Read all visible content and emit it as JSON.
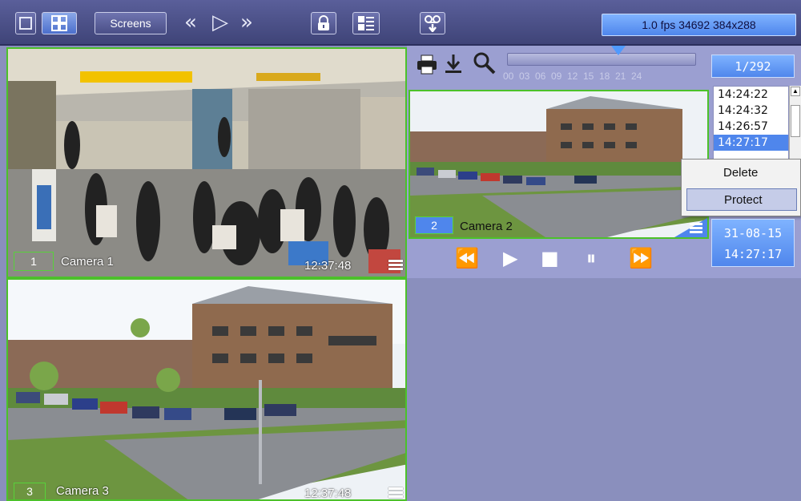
{
  "toolbar": {
    "screens_label": "Screens",
    "fps_status": "1.0 fps  34692 384x288"
  },
  "cameras": [
    {
      "number": "1",
      "name": "Camera 1",
      "time": "12:37:48"
    },
    {
      "number": "2",
      "name": "Camera 2"
    },
    {
      "number": "3",
      "name": "Camera 3",
      "time": "12:37:48"
    }
  ],
  "archive": {
    "timeline_ticks": [
      "00",
      "03",
      "06",
      "09",
      "12",
      "15",
      "18",
      "21",
      "24"
    ],
    "counter": "1/292",
    "times": [
      "14:24:22",
      "14:24:32",
      "14:26:57",
      "14:27:17"
    ],
    "selected_index": 3,
    "date": "31-08-15",
    "time": "14:27:17"
  },
  "context_menu": {
    "items": [
      "Delete",
      "Protect"
    ],
    "hovered": "Protect"
  },
  "colors": {
    "accent_blue": "#4f86ec",
    "tile_border": "#4cc12a",
    "panel_bg": "#8a8fbd"
  }
}
